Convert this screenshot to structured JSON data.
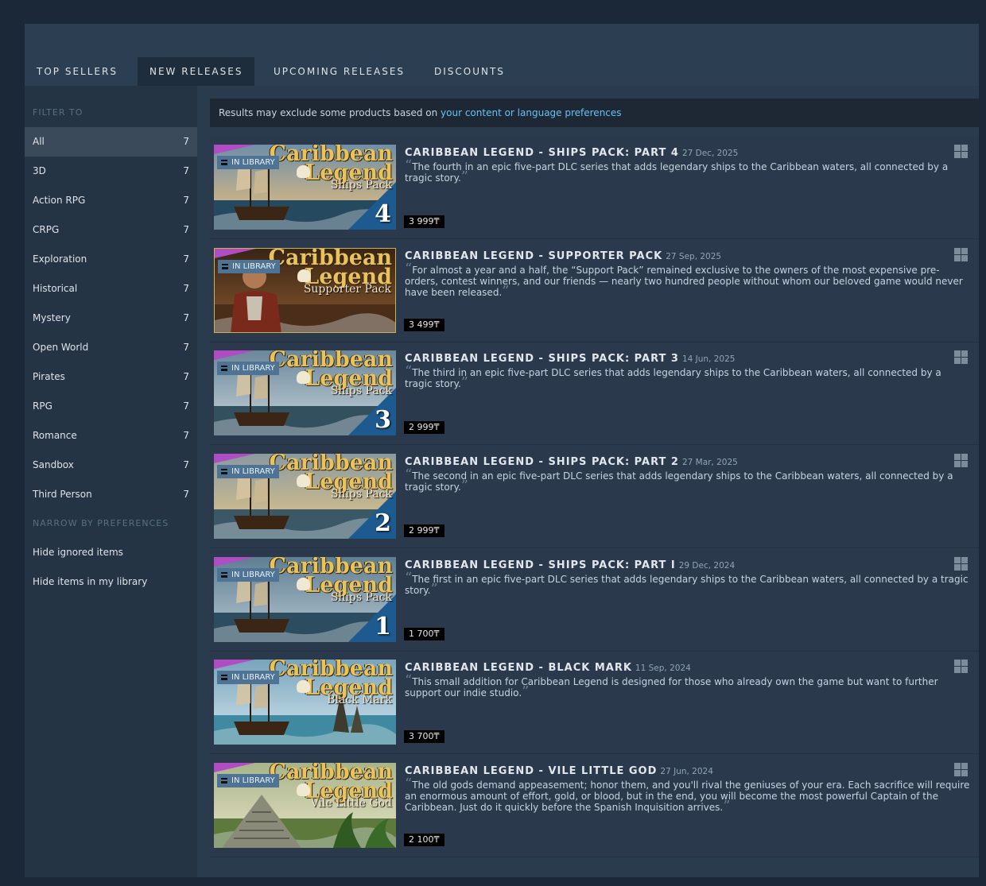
{
  "tabs": [
    {
      "label": "TOP SELLERS",
      "active": false
    },
    {
      "label": "NEW RELEASES",
      "active": true
    },
    {
      "label": "UPCOMING RELEASES",
      "active": false
    },
    {
      "label": "DISCOUNTS",
      "active": false
    }
  ],
  "sidebar": {
    "filter_heading": "FILTER TO",
    "filters": [
      {
        "label": "All",
        "count": "7",
        "active": true
      },
      {
        "label": "3D",
        "count": "7"
      },
      {
        "label": "Action RPG",
        "count": "7"
      },
      {
        "label": "CRPG",
        "count": "7"
      },
      {
        "label": "Exploration",
        "count": "7"
      },
      {
        "label": "Historical",
        "count": "7"
      },
      {
        "label": "Mystery",
        "count": "7"
      },
      {
        "label": "Open World",
        "count": "7"
      },
      {
        "label": "Pirates",
        "count": "7"
      },
      {
        "label": "RPG",
        "count": "7"
      },
      {
        "label": "Romance",
        "count": "7"
      },
      {
        "label": "Sandbox",
        "count": "7"
      },
      {
        "label": "Third Person",
        "count": "7"
      }
    ],
    "preferences_heading": "NARROW BY PREFERENCES",
    "preferences": [
      "Hide ignored items",
      "Hide items in my library"
    ]
  },
  "notice": {
    "text": "Results may exclude some products based on ",
    "link": "your content or language preferences"
  },
  "in_library_label": "IN LIBRARY",
  "results": [
    {
      "title": "CARIBBEAN LEGEND - SHIPS PACK: PART 4",
      "date": "27 Dec, 2025",
      "description": "The fourth in an epic five-part DLC series that adds legendary ships to the Caribbean waters, all connected by a tragic story.",
      "price": "3 999₸",
      "capsule": {
        "title_line1": "Caribbean",
        "title_line2": "Legend",
        "subtitle": "Ships Pack",
        "number": "4"
      }
    },
    {
      "title": "CARIBBEAN LEGEND - SUPPORTER PACK",
      "date": "27 Sep, 2025",
      "description": "For almost a year and a half, the “Support Pack” remained exclusive to the owners of the most expensive pre-orders, contest winners, and our friends — nearly two hundred people without whom our beloved game would never have been released.",
      "price": "3 499₸",
      "capsule": {
        "title_line1": "Caribbean",
        "title_line2": "Legend",
        "subtitle": "Supporter Pack",
        "number": ""
      }
    },
    {
      "title": "CARIBBEAN LEGEND - SHIPS PACK: PART 3",
      "date": "14 Jun, 2025",
      "description": "The third in an epic five-part DLC series that adds legendary ships to the Caribbean waters, all connected by a tragic story.",
      "price": "2 999₸",
      "capsule": {
        "title_line1": "Caribbean",
        "title_line2": "Legend",
        "subtitle": "Ships Pack",
        "number": "3"
      }
    },
    {
      "title": "CARIBBEAN LEGEND - SHIPS PACK: PART 2",
      "date": "27 Mar, 2025",
      "description": "The second in an epic five-part DLC series that adds legendary ships to the Caribbean waters, all connected by a tragic story.",
      "price": "2 999₸",
      "capsule": {
        "title_line1": "Caribbean",
        "title_line2": "Legend",
        "subtitle": "Ships Pack",
        "number": "2"
      }
    },
    {
      "title": "CARIBBEAN LEGEND - SHIPS PACK: PART I",
      "date": "29 Dec, 2024",
      "description": "The first in an epic five-part DLC series that adds legendary ships to the Caribbean waters, all connected by a tragic story.",
      "price": "1 700₸",
      "capsule": {
        "title_line1": "Caribbean",
        "title_line2": "Legend",
        "subtitle": "Ships Pack",
        "number": "1"
      }
    },
    {
      "title": "CARIBBEAN LEGEND - BLACK MARK",
      "date": "11 Sep, 2024",
      "description": "This small addition for Caribbean Legend is designed for those who already own the game but want to further support our indie studio.",
      "price": "3 700₸",
      "capsule": {
        "title_line1": "Caribbean",
        "title_line2": "Legend",
        "subtitle": "Black Mark",
        "number": ""
      }
    },
    {
      "title": "CARIBBEAN LEGEND - VILE LITTLE GOD",
      "date": "27 Jun, 2024",
      "description": "The old gods demand appeasement; honor them, and you'll rival the geniuses of your era. Each sacrifice will require an enormous amount of effort, gold, or blood, but in the end, you will become the most powerful Captain of the Caribbean. Just do it quickly before the Spanish Inquisition arrives.",
      "price": "2 100₸",
      "capsule": {
        "title_line1": "Caribbean",
        "title_line2": "Legend",
        "subtitle": "Vile Little God",
        "number": ""
      }
    }
  ],
  "colors": {
    "accent_link": "#67c1f5",
    "in_library_badge": "#4f7395",
    "corner_purple": "#b04cc4",
    "price_bg": "#000000"
  }
}
